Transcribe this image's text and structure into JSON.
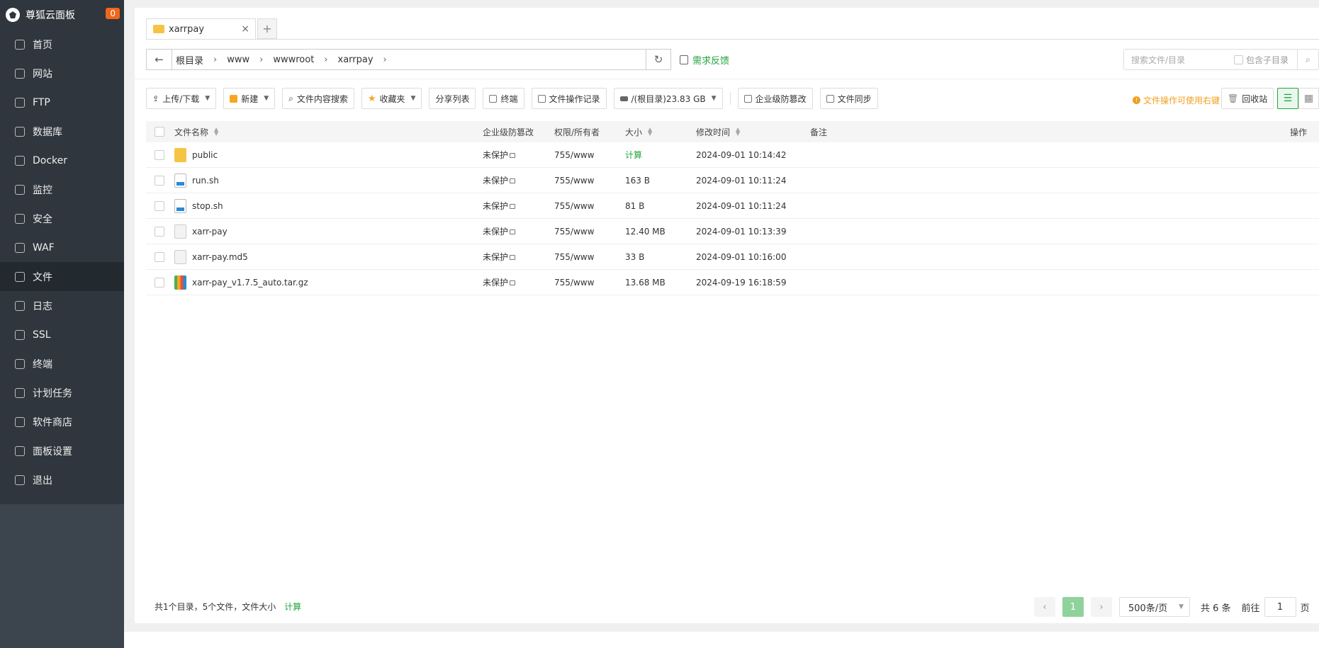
{
  "sidebar": {
    "brand": "尊狐云面板",
    "badge": "0",
    "items": [
      {
        "label": "首页",
        "name": "home"
      },
      {
        "label": "网站",
        "name": "website"
      },
      {
        "label": "FTP",
        "name": "ftp"
      },
      {
        "label": "数据库",
        "name": "database"
      },
      {
        "label": "Docker",
        "name": "docker"
      },
      {
        "label": "监控",
        "name": "monitor"
      },
      {
        "label": "安全",
        "name": "security"
      },
      {
        "label": "WAF",
        "name": "waf"
      },
      {
        "label": "文件",
        "name": "files",
        "active": true
      },
      {
        "label": "日志",
        "name": "logs"
      },
      {
        "label": "SSL",
        "name": "ssl"
      },
      {
        "label": "终端",
        "name": "terminal"
      },
      {
        "label": "计划任务",
        "name": "cron"
      },
      {
        "label": "软件商店",
        "name": "store"
      },
      {
        "label": "面板设置",
        "name": "settings"
      },
      {
        "label": "退出",
        "name": "logout"
      }
    ]
  },
  "tabs": {
    "current": "xarrpay",
    "add": "+",
    "close": "×"
  },
  "address": {
    "crumbs": [
      "根目录",
      "www",
      "wwwroot",
      "xarrpay"
    ],
    "feedback": "需求反馈",
    "search_placeholder": "搜索文件/目录",
    "include_sub": "包含子目录"
  },
  "toolbar": {
    "upload": "上传/下载",
    "new": "新建",
    "content_search": "文件内容搜索",
    "favorites": "收藏夹",
    "share_list": "分享列表",
    "terminal": "终端",
    "op_log": "文件操作记录",
    "disk": "/(根目录)23.83 GB",
    "tamper": "企业级防篡改",
    "sync": "文件同步",
    "tip": "文件操作可使用右键",
    "recycle": "回收站"
  },
  "table": {
    "headers": {
      "name": "文件名称",
      "tamper": "企业级防篡改",
      "perm": "权限/所有者",
      "size": "大小",
      "mtime": "修改时间",
      "note": "备注",
      "ops": "操作"
    },
    "rows": [
      {
        "type": "folder",
        "name": "public",
        "tamper": "未保护",
        "perm": "755/www",
        "size": "计算",
        "mtime": "2024-09-01 10:14:42"
      },
      {
        "type": "sh",
        "name": "run.sh",
        "tamper": "未保护",
        "perm": "755/www",
        "size": "163 B",
        "mtime": "2024-09-01 10:11:24"
      },
      {
        "type": "sh",
        "name": "stop.sh",
        "tamper": "未保护",
        "perm": "755/www",
        "size": "81 B",
        "mtime": "2024-09-01 10:11:24"
      },
      {
        "type": "file",
        "name": "xarr-pay",
        "tamper": "未保护",
        "perm": "755/www",
        "size": "12.40 MB",
        "mtime": "2024-09-01 10:13:39"
      },
      {
        "type": "file",
        "name": "xarr-pay.md5",
        "tamper": "未保护",
        "perm": "755/www",
        "size": "33 B",
        "mtime": "2024-09-01 10:16:00"
      },
      {
        "type": "gz",
        "name": "xarr-pay_v1.7.5_auto.tar.gz",
        "tamper": "未保护",
        "perm": "755/www",
        "size": "13.68 MB",
        "mtime": "2024-09-19 16:18:59"
      }
    ]
  },
  "footer": {
    "summary": "共1个目录，5个文件，文件大小",
    "calc": "计算",
    "page": "1",
    "page_size": "500条/页",
    "total": "共 6 条",
    "goto": "前往",
    "goto_value": "1",
    "page_unit": "页"
  }
}
